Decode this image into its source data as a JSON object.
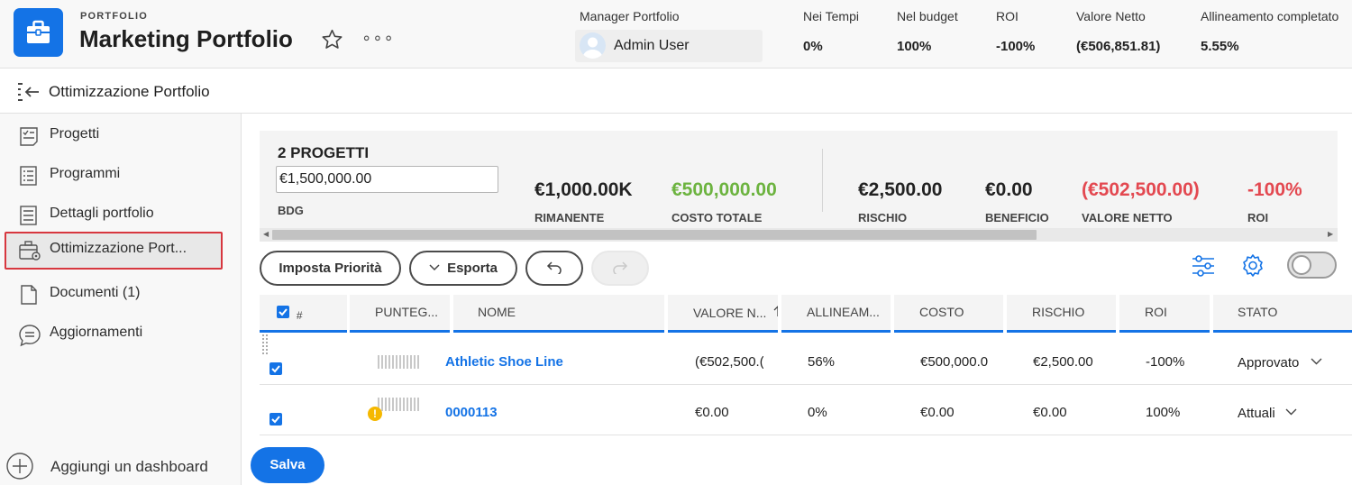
{
  "header": {
    "kicker": "PORTFOLIO",
    "title": "Marketing Portfolio",
    "more_label": "∘∘∘",
    "manager_label": "Manager Portfolio",
    "manager_name": "Admin User",
    "stats": [
      {
        "label": "Nei Tempi",
        "value": "0%"
      },
      {
        "label": "Nel budget",
        "value": "100%"
      },
      {
        "label": "ROI",
        "value": "-100%"
      },
      {
        "label": "Valore Netto",
        "value": "(€506,851.81)"
      },
      {
        "label": "Allineamento completato",
        "value": "5.55%"
      }
    ]
  },
  "subheader": {
    "title": "Ottimizzazione Portfolio",
    "back_icon": "collapse-back-icon"
  },
  "sidebar": {
    "items": [
      {
        "label": "Progetti",
        "icon": "projects-icon"
      },
      {
        "label": "Programmi",
        "icon": "programs-icon"
      },
      {
        "label": "Dettagli portfolio",
        "icon": "details-icon"
      },
      {
        "label": "Ottimizzazione Port...",
        "icon": "briefcase-gear-icon",
        "active": true
      },
      {
        "label": "Documenti (1)",
        "icon": "document-icon"
      },
      {
        "label": "Aggiornamenti",
        "icon": "comment-icon"
      }
    ],
    "add_dashboard": "Aggiungi un dashboard"
  },
  "summary": {
    "title": "2 PROGETTI",
    "budget_value": "€1,500,000.00",
    "budget_label": "BDG",
    "metrics": [
      {
        "value": "€1,000.00K",
        "label": "RIMANENTE"
      },
      {
        "value": "€500,000.00",
        "label": "COSTO TOTALE"
      },
      {
        "value": "€2,500.00",
        "label": "RISCHIO"
      },
      {
        "value": "€0.00",
        "label": "BENEFICIO"
      },
      {
        "value": "(€502,500.00)",
        "label": "VALORE NETTO"
      },
      {
        "value": "-100%",
        "label": "ROI"
      }
    ]
  },
  "toolbar": {
    "priority": "Imposta Priorità",
    "export": "Esporta",
    "undo_icon": "undo-icon",
    "redo_icon": "redo-icon"
  },
  "table": {
    "headers": {
      "hash": "#",
      "score": "PUNTEG...",
      "name": "NOME",
      "net_value": "VALORE N...",
      "alignment": "ALLINEAM...",
      "cost": "COSTO",
      "risk": "RISCHIO",
      "roi": "ROI",
      "status": "STATO"
    },
    "rows": [
      {
        "name": "Athletic Shoe Line",
        "net_value": "(€502,500.(",
        "alignment": "56%",
        "cost": "€500,000.0",
        "risk": "€2,500.00",
        "roi": "-100%",
        "status": "Approvato",
        "warning": false
      },
      {
        "name": "0000113",
        "net_value": "€0.00",
        "alignment": "0%",
        "cost": "€0.00",
        "risk": "€0.00",
        "roi": "100%",
        "status": "Attuali",
        "warning": true,
        "warning_glyph": "!"
      }
    ]
  },
  "save_label": "Salva",
  "colors": {
    "accent": "#1473e6",
    "positive": "#6cb33f",
    "negative": "#e34850",
    "highlight_border": "#d7373f"
  }
}
